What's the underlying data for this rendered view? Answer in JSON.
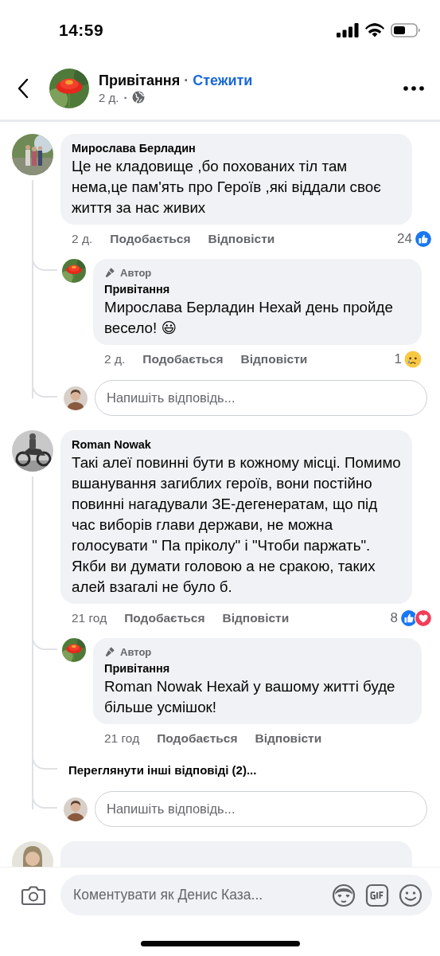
{
  "status_bar": {
    "time": "14:59"
  },
  "header": {
    "page_name": "Привітання",
    "separator": "·",
    "follow_label": "Стежити",
    "age": "2 д.",
    "meta_separator": "·"
  },
  "comments": [
    {
      "author": "Мирослава Берладин",
      "text": "Це не кладовище ,бо похованих тіл там нема,це пам'ять про Героїв ,які віддали своє життя за нас живих",
      "time": "2 д.",
      "like_label": "Подобається",
      "reply_label": "Відповісти",
      "reaction_count": "24",
      "reactions": [
        {
          "kind": "like"
        }
      ],
      "replies": [
        {
          "badge": "Автор",
          "author": "Привітання",
          "text": "Мирослава Берладин Нехай день пройде весело! 😃",
          "time": "2 д.",
          "like_label": "Подобається",
          "reply_label": "Відповісти",
          "reaction_count": "1",
          "reactions": [
            {
              "kind": "sad"
            }
          ]
        }
      ],
      "reply_placeholder": "Напишіть відповідь..."
    },
    {
      "author": "Roman Nowak",
      "text": "Такі алеї повинні бути в кожному місці. Помимо вшанування загиблих  героїв,  вони постійно повинні нагадували ЗЕ-дегенератам, що під час виборів глави держави, не можна голосувати \" Па пріколу\" і \"Чтоби паржать\". Якби ви думати головою а не сракою, таких алей взагалі не було б.",
      "time": "21 год",
      "like_label": "Подобається",
      "reply_label": "Відповісти",
      "reaction_count": "8",
      "reactions": [
        {
          "kind": "like"
        },
        {
          "kind": "love"
        }
      ],
      "replies": [
        {
          "badge": "Автор",
          "author": "Привітання",
          "text": "Roman Nowak Нехай у вашому житті буде більше усмішок!",
          "time": "21 год",
          "like_label": "Подобається",
          "reply_label": "Відповісти"
        }
      ],
      "more_replies": "Переглянути інші відповіді (2)...",
      "reply_placeholder": "Напишіть відповідь..."
    },
    {
      "cut_off": true
    }
  ],
  "composer": {
    "placeholder": "Коментувати як Денис Каза..."
  }
}
